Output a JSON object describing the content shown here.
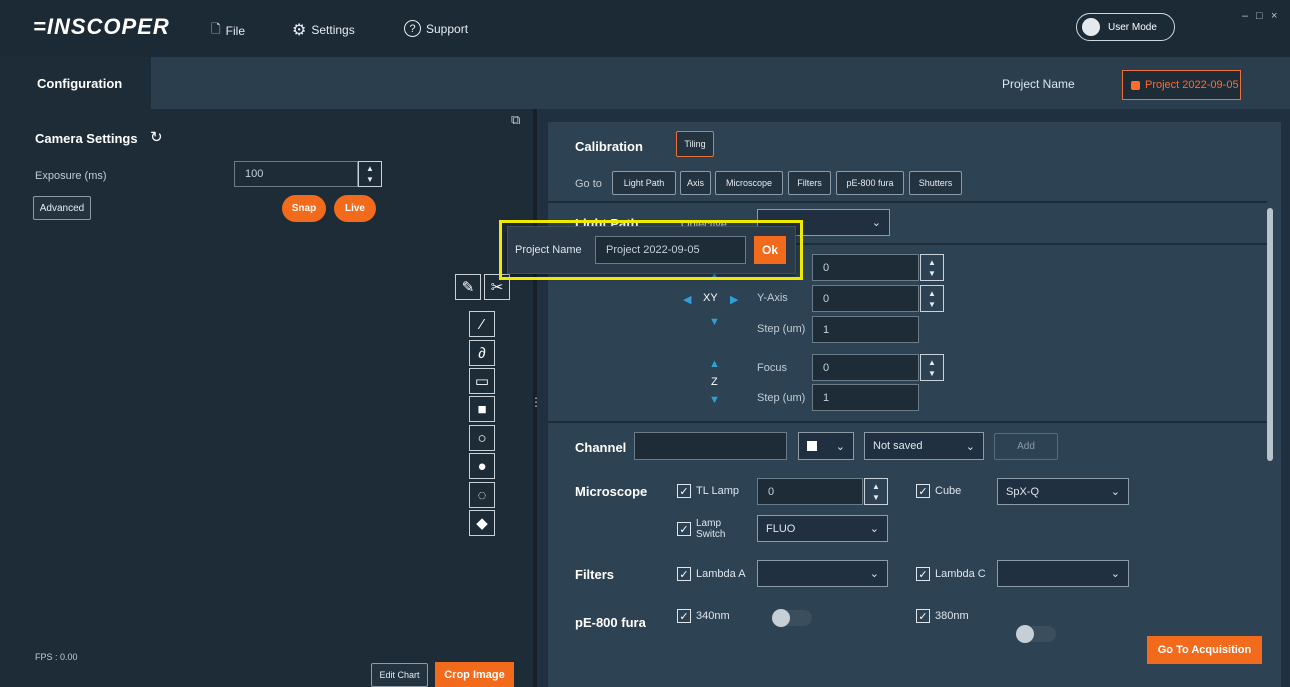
{
  "app": {
    "logo": "=INSCOPER"
  },
  "menu": {
    "file": "File",
    "settings": "Settings",
    "support": "Support"
  },
  "user_mode": "User Mode",
  "window": {
    "minimize": "–",
    "maximize": "□",
    "close": "×"
  },
  "tabs": {
    "configuration": "Configuration"
  },
  "project": {
    "label": "Project Name",
    "value": "Project 2022-09-05"
  },
  "camera": {
    "title": "Camera Settings",
    "exposure_label": "Exposure (ms)",
    "exposure_value": "100",
    "advanced": "Advanced",
    "snap": "Snap",
    "live": "Live",
    "fps": "FPS : 0.00",
    "edit_chart": "Edit Chart",
    "crop_image": "Crop Image"
  },
  "popup": {
    "label": "Project Name",
    "value": "Project 2022-09-05",
    "ok": "Ok"
  },
  "calibration": {
    "title": "Calibration",
    "tiling": "Tiling",
    "goto": "Go to",
    "links": [
      "Light Path",
      "Axis",
      "Microscope",
      "Filters",
      "pE-800 fura",
      "Shutters"
    ]
  },
  "light_path": {
    "title": "Light Path",
    "objective": "Objective"
  },
  "axis": {
    "x_value": "0",
    "xy": "XY",
    "y_label": "Y-Axis",
    "y_value": "0",
    "step_label": "Step (um)",
    "step_xy": "1",
    "focus_label": "Focus",
    "focus_value": "0",
    "z": "Z",
    "step_z": "1"
  },
  "channel": {
    "title": "Channel",
    "status": "Not saved",
    "add": "Add"
  },
  "microscope": {
    "title": "Microscope",
    "tl_lamp": "TL Lamp",
    "tl_value": "0",
    "cube": "Cube",
    "cube_value": "SpX-Q",
    "lamp_switch_1": "Lamp",
    "lamp_switch_2": "Switch",
    "lamp_value": "FLUO"
  },
  "filters": {
    "title": "Filters",
    "lambda_a": "Lambda A",
    "lambda_c": "Lambda C"
  },
  "pe800": {
    "title": "pE-800 fura",
    "nm340": "340nm",
    "nm380": "380nm"
  },
  "go_acquisition": "Go To Acquisition",
  "colors": {
    "accent": "#f26a1b",
    "highlight": "#f0ea00",
    "arrow": "#2fa0d8"
  }
}
